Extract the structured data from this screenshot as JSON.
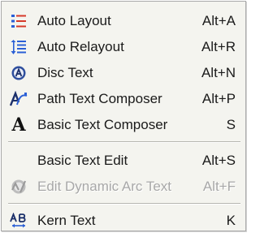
{
  "menu": {
    "items": [
      {
        "label": "Auto Layout",
        "shortcut": "Alt+A",
        "icon": "auto-layout-icon"
      },
      {
        "label": "Auto Relayout",
        "shortcut": "Alt+R",
        "icon": "auto-relayout-icon"
      },
      {
        "label": "Disc Text",
        "shortcut": "Alt+N",
        "icon": "disc-text-icon"
      },
      {
        "label": "Path Text Composer",
        "shortcut": "Alt+P",
        "icon": "path-text-icon"
      },
      {
        "label": "Basic Text Composer",
        "shortcut": "S",
        "icon": "basic-text-icon",
        "glyph": "A"
      },
      {
        "label": "Basic Text Edit",
        "shortcut": "Alt+S"
      },
      {
        "label": "Edit Dynamic Arc Text",
        "shortcut": "Alt+F",
        "icon": "dynamic-arc-text-icon",
        "disabled": true
      },
      {
        "label": "Kern Text",
        "shortcut": "K",
        "icon": "kern-text-icon"
      }
    ]
  },
  "colors": {
    "menu_background": "#f4f4ef",
    "accent_red": "#d63a2a",
    "accent_blue": "#2a5fd6",
    "disabled_text": "#a8a8a8"
  }
}
